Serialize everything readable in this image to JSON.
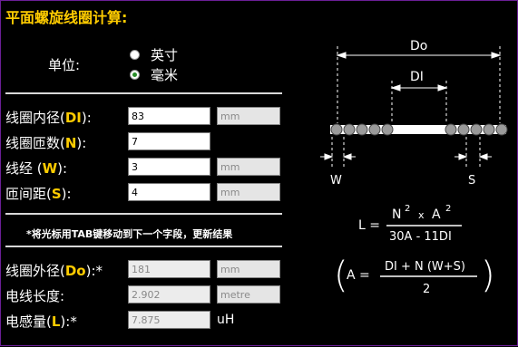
{
  "title": "平面螺旋线圈计算:",
  "units": {
    "label": "单位:",
    "options": [
      "英寸",
      "毫米"
    ],
    "selected": 1
  },
  "inputs": [
    {
      "label": "线圈内径(",
      "sym": "DI",
      "suffix": "):",
      "value": "83",
      "unit": "mm"
    },
    {
      "label": "线圈匝数(",
      "sym": "N",
      "suffix": "):",
      "value": "7",
      "unit": ""
    },
    {
      "label": "线经 (",
      "sym": "W",
      "suffix": "):",
      "value": "3",
      "unit": "mm"
    },
    {
      "label": "匝间距(",
      "sym": "S",
      "suffix": "):",
      "value": "4",
      "unit": "mm"
    }
  ],
  "note": "*将光标用TAB键移动到下一个字段，更新结果",
  "outputs": [
    {
      "label": "线圈外径(",
      "sym": "Do",
      "suffix": "):*",
      "value": "181",
      "unit": "mm"
    },
    {
      "label": "电线长度:",
      "sym": "",
      "suffix": "",
      "value": "2.902",
      "unit": "metre"
    },
    {
      "label": "电感量(",
      "sym": "L",
      "suffix": "):*",
      "value": "7.875",
      "unit": "uH"
    }
  ],
  "diagram": {
    "do_label": "Do",
    "di_label": "DI",
    "w_label": "W",
    "s_label": "S",
    "formula1": {
      "lhs": "L =",
      "num_a": "N",
      "num_exp1": "2",
      "num_x": "x",
      "num_b": "A",
      "num_exp2": "2",
      "den": "30A - 11DI"
    },
    "formula2": {
      "lhs": "A =",
      "num": "DI + N (W+S)",
      "den": "2"
    }
  }
}
